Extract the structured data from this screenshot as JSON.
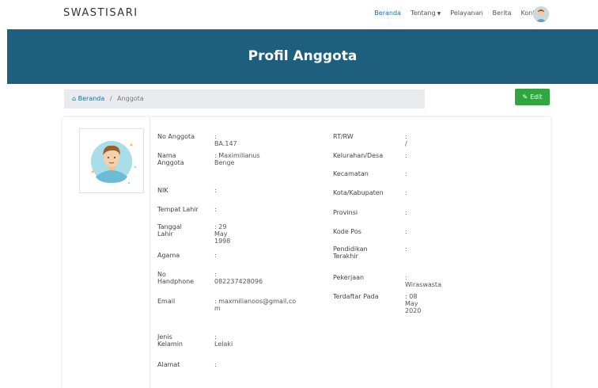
{
  "brand": "SWASTISARI",
  "nav": {
    "items": [
      {
        "label": "Beranda",
        "active": true
      },
      {
        "label": "Tentang",
        "dropdown": true
      },
      {
        "label": "Pelayanan"
      },
      {
        "label": "Berita"
      },
      {
        "label": "Kontak"
      }
    ]
  },
  "hero": {
    "title": "Profil Anggota"
  },
  "breadcrumb": {
    "home": "Beranda",
    "separator": "/",
    "current": "Anggota"
  },
  "edit_button": {
    "label": "Edit"
  },
  "profile_left": [
    {
      "label": "No Anggota",
      "value": ": BA.147"
    },
    {
      "label": "Nama Anggota",
      "value": ": Maximilianus Benge"
    },
    {
      "label": "NIK",
      "value": ":"
    },
    {
      "label": "Tempat Lahir",
      "value": ":"
    },
    {
      "label": "Tanggal Lahir",
      "value": ": 29 May 1998"
    },
    {
      "label": "Agama",
      "value": ":"
    },
    {
      "label": "No Handphone",
      "value": ": 082237428096"
    },
    {
      "label": "Email",
      "value": ": maxmilianoos@gmail.com"
    },
    {
      "label": "Jenis Kelamin",
      "value": ": Lelaki"
    },
    {
      "label": "Alamat",
      "value": ":"
    }
  ],
  "profile_right": [
    {
      "label": "RT/RW",
      "value": ": /"
    },
    {
      "label": "Kelurahan/Desa",
      "value": ":"
    },
    {
      "label": "Kecamatan",
      "value": ":"
    },
    {
      "label": "Kota/Kabupaten",
      "value": ":"
    },
    {
      "label": "Provinsi",
      "value": ":"
    },
    {
      "label": "Kode Pos",
      "value": ":"
    },
    {
      "label": "Pendidikan Terakhir",
      "value": ":"
    },
    {
      "label": "Pekerjaan",
      "value": ": Wiraswasta"
    },
    {
      "label": "Terdaftar Pada",
      "value": ": 08 May 2020"
    }
  ],
  "colors": {
    "hero_bg": "#1e5f7d",
    "edit_bg": "#2fa63f",
    "link": "#1a6fa3",
    "breadcrumb_bg": "#e9ecef"
  },
  "icons": {
    "home": "home-icon",
    "edit": "pencil-icon",
    "caret": "chevron-down-icon"
  }
}
